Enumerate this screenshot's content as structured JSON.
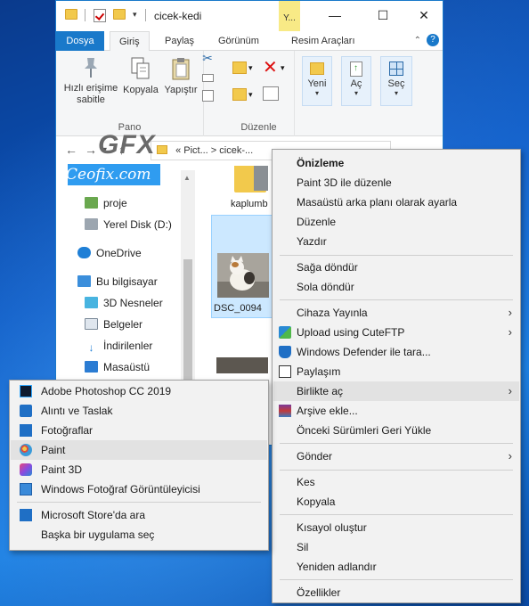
{
  "window": {
    "title": "cicek-kedi",
    "tools_tab": "Y...",
    "controls": {
      "minimize": "—",
      "maximize": "☐",
      "close": "✕"
    }
  },
  "ribbon": {
    "tabs": [
      "Dosya",
      "Giriş",
      "Paylaş",
      "Görünüm",
      "Resim Araçları"
    ],
    "pin_label_1": "Hızlı erişime",
    "pin_label_2": "sabitle",
    "copy": "Kopyala",
    "paste": "Yapıştır",
    "group_clipboard": "Pano",
    "group_organize": "Düzenle",
    "new": "Yeni",
    "open": "Aç",
    "select": "Seç"
  },
  "address": {
    "path": "« Pict...  >  cicek-..."
  },
  "navigation": {
    "items": [
      {
        "label": "proje",
        "icon": "git-folder-icon"
      },
      {
        "label": "Yerel Disk (D:)",
        "icon": "drive-icon"
      },
      {
        "label": "OneDrive",
        "icon": "cloud-icon"
      },
      {
        "label": "Bu bilgisayar",
        "icon": "computer-icon"
      },
      {
        "label": "3D Nesneler",
        "icon": "3d-objects-icon"
      },
      {
        "label": "Belgeler",
        "icon": "documents-icon"
      },
      {
        "label": "İndirilenler",
        "icon": "download-icon"
      },
      {
        "label": "Masaüstü",
        "icon": "desktop-icon"
      }
    ]
  },
  "files": [
    {
      "name": "kaplumb"
    },
    {
      "name": "DSC_0094"
    }
  ],
  "watermark": {
    "brand": "GFX",
    "site": "Ceofix.com"
  },
  "context_menu": {
    "items": [
      {
        "label": "Önizleme",
        "bold": true
      },
      {
        "label": "Paint 3D ile düzenle"
      },
      {
        "label": "Masaüstü arka planı olarak ayarla"
      },
      {
        "label": "Düzenle"
      },
      {
        "label": "Yazdır"
      },
      {
        "label": "Sağa döndür"
      },
      {
        "label": "Sola döndür"
      },
      {
        "label": "Cihaza Yayınla"
      },
      {
        "label": "Upload using CuteFTP"
      },
      {
        "label": "Windows Defender ile tara..."
      },
      {
        "label": "Paylaşım"
      },
      {
        "label": "Birlikte aç"
      },
      {
        "label": "Arşive ekle..."
      },
      {
        "label": "Önceki Sürümleri Geri Yükle"
      },
      {
        "label": "Gönder"
      },
      {
        "label": "Kes"
      },
      {
        "label": "Kopyala"
      },
      {
        "label": "Kısayol oluştur"
      },
      {
        "label": "Sil"
      },
      {
        "label": "Yeniden adlandır"
      },
      {
        "label": "Özellikler"
      }
    ]
  },
  "open_with_menu": {
    "items": [
      {
        "label": "Adobe Photoshop CC 2019",
        "icon": "photoshop-icon"
      },
      {
        "label": "Alıntı ve Taslak",
        "icon": "snip-sketch-icon"
      },
      {
        "label": "Fotoğraflar",
        "icon": "photos-icon"
      },
      {
        "label": "Paint",
        "icon": "paint-icon"
      },
      {
        "label": "Paint 3D",
        "icon": "paint3d-icon"
      },
      {
        "label": "Windows Fotoğraf Görüntüleyicisi",
        "icon": "photo-viewer-icon"
      },
      {
        "label": "Microsoft Store'da ara",
        "icon": "store-icon"
      },
      {
        "label": "Başka bir uygulama seç"
      }
    ]
  }
}
